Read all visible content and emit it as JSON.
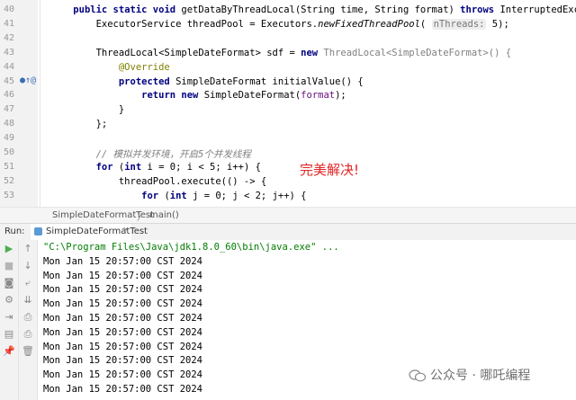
{
  "editor": {
    "line_numbers": [
      "40",
      "41",
      "42",
      "43",
      "44",
      "45",
      "46",
      "47",
      "48",
      "49",
      "50",
      "51",
      "52",
      "53"
    ],
    "gutter_marker": "●↑@",
    "lines": [
      [
        {
          "t": "    "
        },
        {
          "t": "public static void ",
          "c": "kw"
        },
        {
          "t": "getDataByThreadLocal(String time, String format) "
        },
        {
          "t": "throws ",
          "c": "kw"
        },
        {
          "t": "InterruptedException {"
        }
      ],
      [
        {
          "t": "        ExecutorService threadPool = Executors."
        },
        {
          "t": "newFixedThreadPool",
          "c": "it"
        },
        {
          "t": "( "
        },
        {
          "t": "nThreads:",
          "c": "hint"
        },
        {
          "t": " 5);"
        }
      ],
      [],
      [
        {
          "t": "        ThreadLocal<SimpleDateFormat> sdf = "
        },
        {
          "t": "new ",
          "c": "kw"
        },
        {
          "t": "ThreadLocal<SimpleDateFormat>() {",
          "c": "gray"
        }
      ],
      [
        {
          "t": "            "
        },
        {
          "t": "@Override",
          "c": "ann"
        }
      ],
      [
        {
          "t": "            "
        },
        {
          "t": "protected ",
          "c": "kw"
        },
        {
          "t": "SimpleDateFormat initialValue() {"
        }
      ],
      [
        {
          "t": "                "
        },
        {
          "t": "return new ",
          "c": "kw"
        },
        {
          "t": "SimpleDateFormat("
        },
        {
          "t": "format",
          "c": "param"
        },
        {
          "t": ");"
        }
      ],
      [
        {
          "t": "            }"
        }
      ],
      [
        {
          "t": "        };"
        }
      ],
      [],
      [
        {
          "t": "        "
        },
        {
          "t": "// 模拟并发环境，开启5个并发线程",
          "c": "cmt"
        }
      ],
      [
        {
          "t": "        "
        },
        {
          "t": "for ",
          "c": "kw"
        },
        {
          "t": "("
        },
        {
          "t": "int ",
          "c": "kw"
        },
        {
          "t": "i = 0; i < 5; i++) {"
        }
      ],
      [
        {
          "t": "            threadPool.execute(() -> {"
        }
      ],
      [
        {
          "t": "                "
        },
        {
          "t": "for ",
          "c": "kw"
        },
        {
          "t": "("
        },
        {
          "t": "int ",
          "c": "kw"
        },
        {
          "t": "j = 0; j < 2; j++) {"
        }
      ]
    ],
    "annotation_text": "完美解决!",
    "colors": {
      "keyword": "#000080",
      "annotation": "#808000",
      "param": "#660e7a",
      "comment": "#808080",
      "note": "#e32424"
    }
  },
  "breadcrumb": {
    "items": [
      "SimpleDateFormatTest",
      "main()"
    ],
    "separator": "〉"
  },
  "run_panel": {
    "label": "Run:",
    "tab_label": "SimpleDateFormatTest",
    "tab_close": "×",
    "left_tools": [
      {
        "name": "run-icon",
        "glyph": "▶",
        "color": "#4caf50"
      },
      {
        "name": "stop-icon",
        "glyph": "■",
        "color": "#b5b5b5"
      },
      {
        "name": "camera-icon",
        "glyph": "◙",
        "color": "#8a8a8a"
      },
      {
        "name": "debug-icon",
        "glyph": "⚙",
        "color": "#8a8a8a"
      },
      {
        "name": "exit-icon",
        "glyph": "⇥",
        "color": "#8a8a8a"
      },
      {
        "name": "layout-icon",
        "glyph": "▤",
        "color": "#8a8a8a"
      },
      {
        "name": "pin-icon",
        "glyph": "📌",
        "color": "#8a8a8a"
      }
    ],
    "right_tools": [
      {
        "name": "up-arrow-icon",
        "glyph": "↑",
        "color": "#8a8a8a"
      },
      {
        "name": "down-arrow-icon",
        "glyph": "↓",
        "color": "#8a8a8a"
      },
      {
        "name": "soft-wrap-icon",
        "glyph": "⤶",
        "color": "#8a8a8a"
      },
      {
        "name": "scroll-to-end-icon",
        "glyph": "⇊",
        "color": "#8a8a8a"
      },
      {
        "name": "print-icon",
        "glyph": "⎙",
        "color": "#8a8a8a"
      },
      {
        "name": "print-icon-2",
        "glyph": "⎙",
        "color": "#8a8a8a"
      },
      {
        "name": "trash-icon",
        "glyph": "🗑",
        "color": "#8a8a8a"
      }
    ],
    "console_lines": [
      "\"C:\\Program Files\\Java\\jdk1.8.0_60\\bin\\java.exe\" ...",
      "Mon Jan 15 20:57:00 CST 2024",
      "Mon Jan 15 20:57:00 CST 2024",
      "Mon Jan 15 20:57:00 CST 2024",
      "Mon Jan 15 20:57:00 CST 2024",
      "Mon Jan 15 20:57:00 CST 2024",
      "Mon Jan 15 20:57:00 CST 2024",
      "Mon Jan 15 20:57:00 CST 2024",
      "Mon Jan 15 20:57:00 CST 2024",
      "Mon Jan 15 20:57:00 CST 2024",
      "Mon Jan 15 20:57:00 CST 2024"
    ]
  },
  "watermark": {
    "text": "公众号 · 哪吒编程"
  }
}
